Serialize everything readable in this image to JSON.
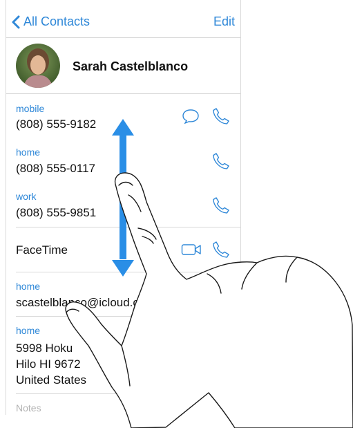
{
  "nav": {
    "back_label": "All Contacts",
    "edit_label": "Edit"
  },
  "contact": {
    "name": "Sarah Castelblanco"
  },
  "fields": [
    {
      "label": "mobile",
      "value": "(808) 555-9182"
    },
    {
      "label": "home",
      "value": "(808) 555-0117"
    },
    {
      "label": "work",
      "value": "(808) 555-9851"
    }
  ],
  "facetime_label": "FaceTime",
  "email": {
    "label": "home",
    "value": "scastelblanco@icloud.com"
  },
  "address": {
    "label": "home",
    "line1": "5998 Hoku",
    "line2": "Hilo HI 9672",
    "line3": "United States"
  },
  "notes_label": "Notes",
  "colors": {
    "accent": "#2f88d8",
    "arrow": "#2a8ee6"
  },
  "icons": [
    "chevron-left-icon",
    "message-icon",
    "phone-icon",
    "video-icon"
  ]
}
